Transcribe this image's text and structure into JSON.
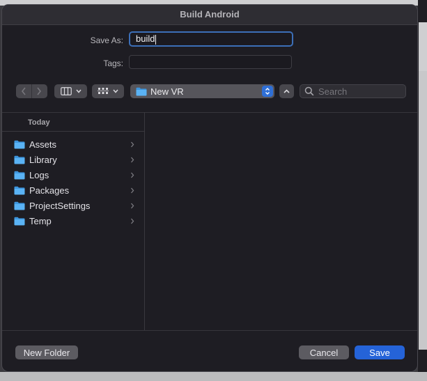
{
  "dialog": {
    "title": "Build Android"
  },
  "form": {
    "save_as_label": "Save As:",
    "save_as_value": "build",
    "tags_label": "Tags:",
    "tags_value": ""
  },
  "toolbar": {
    "location": "New VR",
    "search_placeholder": "Search"
  },
  "sidebar": {
    "header": "Today",
    "items": [
      {
        "label": "Assets"
      },
      {
        "label": "Library"
      },
      {
        "label": "Logs"
      },
      {
        "label": "Packages"
      },
      {
        "label": "ProjectSettings"
      },
      {
        "label": "Temp"
      }
    ]
  },
  "footer": {
    "new_folder_label": "New Folder",
    "cancel_label": "Cancel",
    "save_label": "Save"
  },
  "colors": {
    "accent": "#2563d8",
    "folder": "#4aa8f0",
    "dialog_bg": "#1e1d23"
  }
}
